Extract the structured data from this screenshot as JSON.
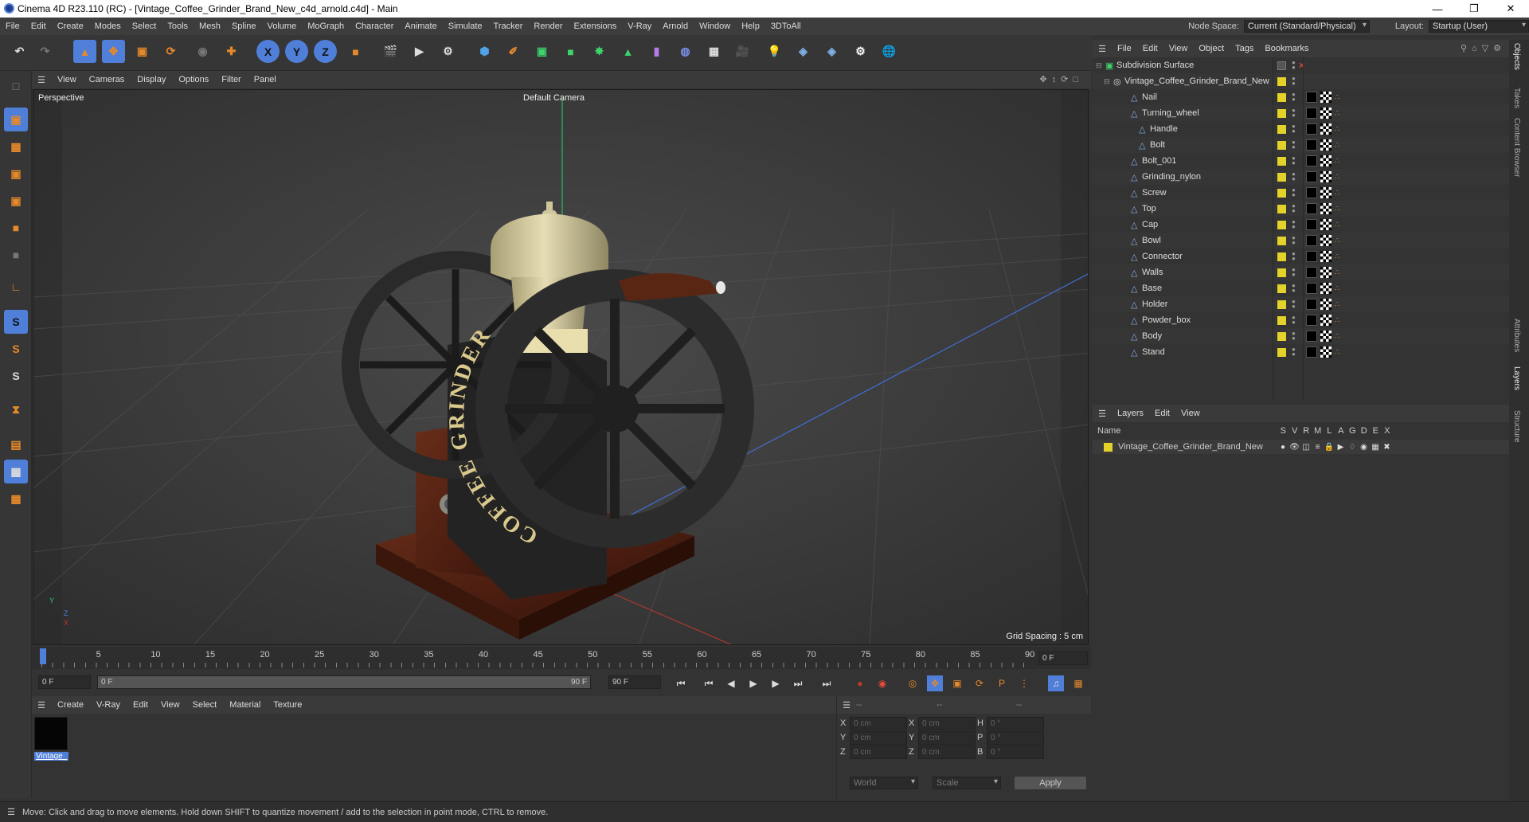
{
  "window": {
    "title": "Cinema 4D R23.110 (RC) - [Vintage_Coffee_Grinder_Brand_New_c4d_arnold.c4d] - Main"
  },
  "menubar": {
    "items": [
      "File",
      "Edit",
      "Create",
      "Modes",
      "Select",
      "Tools",
      "Mesh",
      "Spline",
      "Volume",
      "MoGraph",
      "Character",
      "Animate",
      "Simulate",
      "Tracker",
      "Render",
      "Extensions",
      "V-Ray",
      "Arnold",
      "Window",
      "Help",
      "3DToAll"
    ],
    "node_space_label": "Node Space:",
    "node_space_value": "Current (Standard/Physical)",
    "layout_label": "Layout:",
    "layout_value": "Startup (User)"
  },
  "toolbar": {
    "x": "X",
    "y": "Y",
    "z": "Z"
  },
  "viewport_menu": [
    "View",
    "Cameras",
    "Display",
    "Options",
    "Filter",
    "Panel"
  ],
  "viewport": {
    "label": "Perspective",
    "camera": "Default Camera",
    "grid_spacing": "Grid Spacing : 5 cm",
    "axis_y": "Y",
    "axis_z": "Z",
    "axis_x": "X",
    "text_arc": "COFFEE GRINDER"
  },
  "timeline": {
    "ticks": [
      "0",
      "5",
      "10",
      "15",
      "20",
      "25",
      "30",
      "35",
      "40",
      "45",
      "50",
      "55",
      "60",
      "65",
      "70",
      "75",
      "80",
      "85",
      "90"
    ],
    "current_frame": "0 F"
  },
  "transport": {
    "start": "0 F",
    "current": "0 F",
    "end_inner": "90 F",
    "end": "90 F"
  },
  "material_menu": [
    "Create",
    "V-Ray",
    "Edit",
    "View",
    "Select",
    "Material",
    "Texture"
  ],
  "materials": [
    {
      "name": "Vintage_"
    }
  ],
  "coords": {
    "header": [
      "--",
      "--",
      "--"
    ],
    "rows": [
      {
        "a": "X",
        "av": "0 cm",
        "b": "X",
        "bv": "0 cm",
        "c": "H",
        "cv": "0 °"
      },
      {
        "a": "Y",
        "av": "0 cm",
        "b": "Y",
        "bv": "0 cm",
        "c": "P",
        "cv": "0 °"
      },
      {
        "a": "Z",
        "av": "0 cm",
        "b": "Z",
        "bv": "0 cm",
        "c": "B",
        "cv": "0 °"
      }
    ],
    "space": "World",
    "mode": "Scale",
    "apply": "Apply"
  },
  "objects_menu": [
    "File",
    "Edit",
    "View",
    "Object",
    "Tags",
    "Bookmarks"
  ],
  "objects": [
    {
      "name": "Subdivision Surface",
      "level": 0
    },
    {
      "name": "Vintage_Coffee_Grinder_Brand_New",
      "level": 1
    },
    {
      "name": "Nail",
      "level": 2
    },
    {
      "name": "Turning_wheel",
      "level": 2
    },
    {
      "name": "Handle",
      "level": 3
    },
    {
      "name": "Bolt",
      "level": 3
    },
    {
      "name": "Bolt_001",
      "level": 2
    },
    {
      "name": "Grinding_nylon",
      "level": 2
    },
    {
      "name": "Screw",
      "level": 2
    },
    {
      "name": "Top",
      "level": 2
    },
    {
      "name": "Cap",
      "level": 2
    },
    {
      "name": "Bowl",
      "level": 2
    },
    {
      "name": "Connector",
      "level": 2
    },
    {
      "name": "Walls",
      "level": 2
    },
    {
      "name": "Base",
      "level": 2
    },
    {
      "name": "Holder",
      "level": 2
    },
    {
      "name": "Powder_box",
      "level": 2
    },
    {
      "name": "Body",
      "level": 2
    },
    {
      "name": "Stand",
      "level": 2
    }
  ],
  "layers_menu": [
    "Layers",
    "Edit",
    "View"
  ],
  "layers_header": {
    "name": "Name",
    "cols": [
      "S",
      "V",
      "R",
      "M",
      "L",
      "A",
      "G",
      "D",
      "E",
      "X"
    ]
  },
  "layers": [
    {
      "name": "Vintage_Coffee_Grinder_Brand_New"
    }
  ],
  "side_tabs": [
    "Objects",
    "Takes",
    "Content Browser",
    "Attributes",
    "Layers",
    "Structure"
  ],
  "status": "Move: Click and drag to move elements. Hold down SHIFT to quantize movement / add to the selection in point mode, CTRL to remove.",
  "colors": {
    "layer_yellow": "#e3d22a",
    "accent_blue": "#4f7fd9",
    "orange": "#e6892a"
  }
}
